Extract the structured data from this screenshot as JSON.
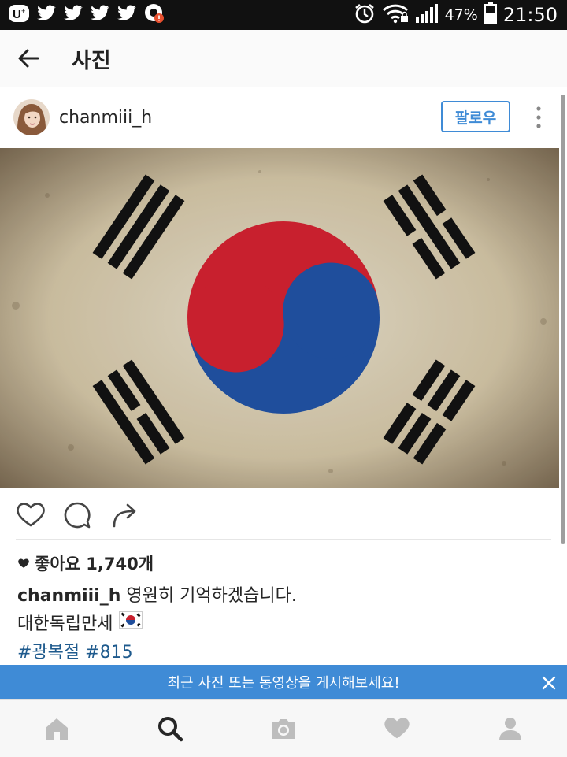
{
  "status_bar": {
    "battery_percent": "47%",
    "time": "21:50",
    "icons": [
      "uplus-icon",
      "twitter-icon",
      "twitter-icon",
      "twitter-icon",
      "twitter-icon",
      "app-notification-icon",
      "alarm-icon",
      "wifi-icon",
      "signal-icon",
      "battery-icon"
    ]
  },
  "app_bar": {
    "title": "사진",
    "back_icon": "arrow-left-icon"
  },
  "post": {
    "username": "chanmiii_h",
    "follow_label": "팔로우",
    "image": "korean-flag-photo",
    "likes": "좋아요 1,740개",
    "caption_user": "chanmiii_h",
    "caption_text": "영원히 기억하겠습니다.",
    "caption_line2": "대한독립만세",
    "hashtags": "#광복절 #815"
  },
  "banner": {
    "text": "최근 사진 또는 동영상을 게시해보세요!"
  },
  "colors": {
    "accent": "#3f8bd6",
    "hashtag": "#1e5a8d",
    "status_bar": "#111111",
    "flag_red": "#c8202e",
    "flag_blue": "#1f4e9c"
  },
  "bottom_nav": [
    "home-icon",
    "search-icon",
    "camera-icon",
    "heart-icon",
    "profile-icon"
  ]
}
